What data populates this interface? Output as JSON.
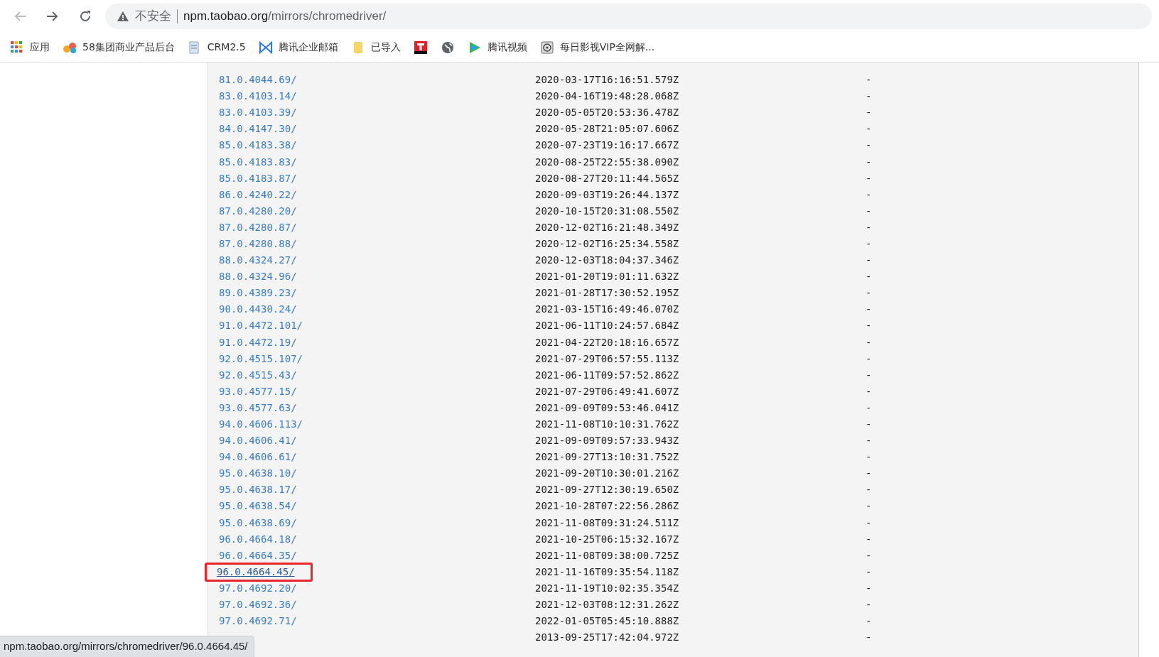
{
  "browser": {
    "nav_buttons": [
      {
        "kind": "back",
        "disabled": true
      },
      {
        "kind": "forward",
        "disabled": false
      },
      {
        "kind": "reload",
        "disabled": false
      }
    ],
    "security_label": "不安全",
    "url_host": "npm.taobao.org",
    "url_path": "/mirrors/chromedriver/"
  },
  "bookmarks": [
    {
      "kind": "apps",
      "label": "应用"
    },
    {
      "kind": "fiftyeight",
      "label": "58集团商业产品后台"
    },
    {
      "kind": "doc",
      "label": "CRM2.5"
    },
    {
      "kind": "mail",
      "label": "腾讯企业邮箱"
    },
    {
      "kind": "folder",
      "label": "已导入"
    },
    {
      "kind": "t"
    },
    {
      "kind": "globe"
    },
    {
      "kind": "video",
      "label": "腾讯视频"
    },
    {
      "kind": "film",
      "label": "每日影视VIP全网解..."
    }
  ],
  "listing": {
    "rows": [
      {
        "name": "81.0.4044.69/",
        "modified": "2020-03-17T16:16:51.579Z",
        "size": "-"
      },
      {
        "name": "83.0.4103.14/",
        "modified": "2020-04-16T19:48:28.068Z",
        "size": "-"
      },
      {
        "name": "83.0.4103.39/",
        "modified": "2020-05-05T20:53:36.478Z",
        "size": "-"
      },
      {
        "name": "84.0.4147.30/",
        "modified": "2020-05-28T21:05:07.606Z",
        "size": "-"
      },
      {
        "name": "85.0.4183.38/",
        "modified": "2020-07-23T19:16:17.667Z",
        "size": "-"
      },
      {
        "name": "85.0.4183.83/",
        "modified": "2020-08-25T22:55:38.090Z",
        "size": "-"
      },
      {
        "name": "85.0.4183.87/",
        "modified": "2020-08-27T20:11:44.565Z",
        "size": "-"
      },
      {
        "name": "86.0.4240.22/",
        "modified": "2020-09-03T19:26:44.137Z",
        "size": "-"
      },
      {
        "name": "87.0.4280.20/",
        "modified": "2020-10-15T20:31:08.550Z",
        "size": "-"
      },
      {
        "name": "87.0.4280.87/",
        "modified": "2020-12-02T16:21:48.349Z",
        "size": "-"
      },
      {
        "name": "87.0.4280.88/",
        "modified": "2020-12-02T16:25:34.558Z",
        "size": "-"
      },
      {
        "name": "88.0.4324.27/",
        "modified": "2020-12-03T18:04:37.346Z",
        "size": "-"
      },
      {
        "name": "88.0.4324.96/",
        "modified": "2021-01-20T19:01:11.632Z",
        "size": "-"
      },
      {
        "name": "89.0.4389.23/",
        "modified": "2021-01-28T17:30:52.195Z",
        "size": "-"
      },
      {
        "name": "90.0.4430.24/",
        "modified": "2021-03-15T16:49:46.070Z",
        "size": "-"
      },
      {
        "name": "91.0.4472.101/",
        "modified": "2021-06-11T10:24:57.684Z",
        "size": "-"
      },
      {
        "name": "91.0.4472.19/",
        "modified": "2021-04-22T20:18:16.657Z",
        "size": "-"
      },
      {
        "name": "92.0.4515.107/",
        "modified": "2021-07-29T06:57:55.113Z",
        "size": "-"
      },
      {
        "name": "92.0.4515.43/",
        "modified": "2021-06-11T09:57:52.862Z",
        "size": "-"
      },
      {
        "name": "93.0.4577.15/",
        "modified": "2021-07-29T06:49:41.607Z",
        "size": "-"
      },
      {
        "name": "93.0.4577.63/",
        "modified": "2021-09-09T09:53:46.041Z",
        "size": "-"
      },
      {
        "name": "94.0.4606.113/",
        "modified": "2021-11-08T10:10:31.762Z",
        "size": "-"
      },
      {
        "name": "94.0.4606.41/",
        "modified": "2021-09-09T09:57:33.943Z",
        "size": "-"
      },
      {
        "name": "94.0.4606.61/",
        "modified": "2021-09-27T13:10:31.752Z",
        "size": "-"
      },
      {
        "name": "95.0.4638.10/",
        "modified": "2021-09-20T10:30:01.216Z",
        "size": "-"
      },
      {
        "name": "95.0.4638.17/",
        "modified": "2021-09-27T12:30:19.650Z",
        "size": "-"
      },
      {
        "name": "95.0.4638.54/",
        "modified": "2021-10-28T07:22:56.286Z",
        "size": "-"
      },
      {
        "name": "95.0.4638.69/",
        "modified": "2021-11-08T09:31:24.511Z",
        "size": "-"
      },
      {
        "name": "96.0.4664.18/",
        "modified": "2021-10-25T06:15:32.167Z",
        "size": "-"
      },
      {
        "name": "96.0.4664.35/",
        "modified": "2021-11-08T09:38:00.725Z",
        "size": "-"
      },
      {
        "name": "96.0.4664.45/",
        "modified": "2021-11-16T09:35:54.118Z",
        "size": "-",
        "highlighted": true
      },
      {
        "name": "97.0.4692.20/",
        "modified": "2021-11-19T10:02:35.354Z",
        "size": "-"
      },
      {
        "name": "97.0.4692.36/",
        "modified": "2021-12-03T08:12:31.262Z",
        "size": "-"
      },
      {
        "name": "97.0.4692.71/",
        "modified": "2022-01-05T05:45:10.888Z",
        "size": "-"
      },
      {
        "modified": "2013-09-25T17:42:04.972Z",
        "size": "-"
      }
    ]
  },
  "status_bar": {
    "url": "npm.taobao.org/mirrors/chromedriver/96.0.4664.45/"
  }
}
